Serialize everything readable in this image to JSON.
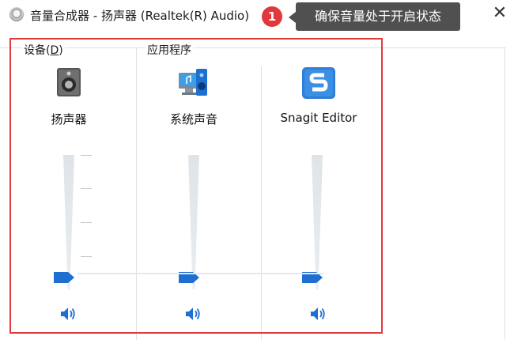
{
  "window": {
    "title": "音量合成器 - 扬声器 (Realtek(R) Audio)",
    "close_symbol": "✕",
    "app_icon": "speaker-dial-icon"
  },
  "annotation": {
    "badge_number": "1",
    "tooltip_text": "确保音量处于开启状态",
    "highlight_color": "#e03a3f",
    "badge_color": "#e0383c",
    "tooltip_bg": "#505050"
  },
  "sections": {
    "devices_label": "设备(D)",
    "devices_mnemonic": "D",
    "apps_label": "应用程序"
  },
  "channels": [
    {
      "name": "扬声器",
      "icon": "speaker-device-icon",
      "volume_fraction": 0.0,
      "mute_icon": "volume-icon"
    },
    {
      "name": "系统声音",
      "icon": "system-sounds-icon",
      "volume_fraction": 0.0,
      "mute_icon": "volume-icon"
    },
    {
      "name": "Snagit Editor",
      "icon": "snagit-icon",
      "volume_fraction": 0.0,
      "mute_icon": "volume-icon"
    }
  ],
  "colors": {
    "accent": "#1e6fd0",
    "track": "#e3e7ea"
  }
}
